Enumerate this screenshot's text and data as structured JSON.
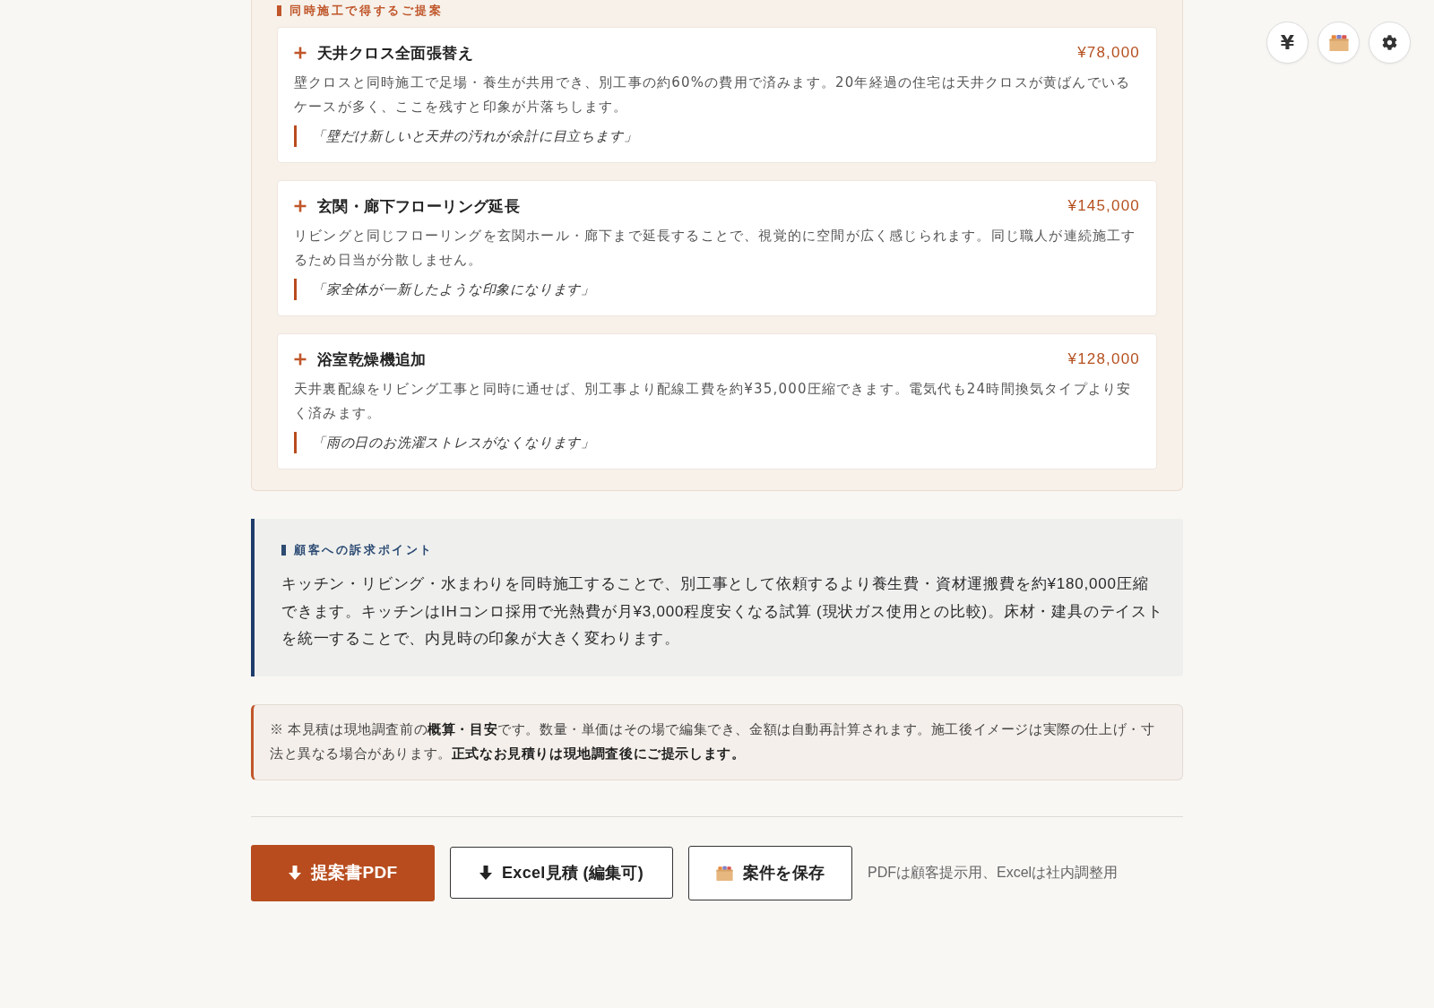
{
  "floating_buttons": [
    {
      "kind": "currency",
      "label": "¥"
    },
    {
      "kind": "storage"
    },
    {
      "kind": "settings"
    }
  ],
  "suggestions": {
    "heading": "同時施工で得するご提案",
    "items": [
      {
        "title": "天井クロス全面張替え",
        "price": "¥78,000",
        "description": "壁クロスと同時施工で足場・養生が共用でき、別工事の約60%の費用で済みます。20年経過の住宅は天井クロスが黄ばんでいるケースが多く、ここを残すと印象が片落ちします。",
        "quote": "「壁だけ新しいと天井の汚れが余計に目立ちます」"
      },
      {
        "title": "玄関・廊下フローリング延長",
        "price": "¥145,000",
        "description": "リビングと同じフローリングを玄関ホール・廊下まで延長することで、視覚的に空間が広く感じられます。同じ職人が連続施工するため日当が分散しません。",
        "quote": "「家全体が一新したような印象になります」"
      },
      {
        "title": "浴室乾燥機追加",
        "price": "¥128,000",
        "description": "天井裏配線をリビング工事と同時に通せば、別工事より配線工費を約¥35,000圧縮できます。電気代も24時間換気タイプより安く済みます。",
        "quote": "「雨の日のお洗濯ストレスがなくなります」"
      }
    ]
  },
  "appeal": {
    "heading": "顧客への訴求ポイント",
    "body": "キッチン・リビング・水まわりを同時施工することで、別工事として依頼するより養生費・資材運搬費を約¥180,000圧縮できます。キッチンはIHコンロ採用で光熱費が月¥3,000程度安くなる試算 (現状ガス使用との比較)。床材・建具のテイストを統一することで、内見時の印象が大きく変わります。"
  },
  "notice": {
    "text": "※ 本見積は現地調査前の**概算・目安**です。数量・単価はその場で編集でき、金額は自動再計算されます。施工後イメージは実際の仕上げ・寸法と異なる場合があります。**正式なお見積りは現地調査後にご提示します。**"
  },
  "actions": {
    "buttons": [
      {
        "kind": "pdf",
        "label": "提案書PDF"
      },
      {
        "kind": "excel",
        "label": "Excel見積 (編集可)"
      },
      {
        "kind": "save",
        "label": "案件を保存"
      }
    ],
    "note": "PDFは顧客提示用、Excelは社内調整用"
  }
}
